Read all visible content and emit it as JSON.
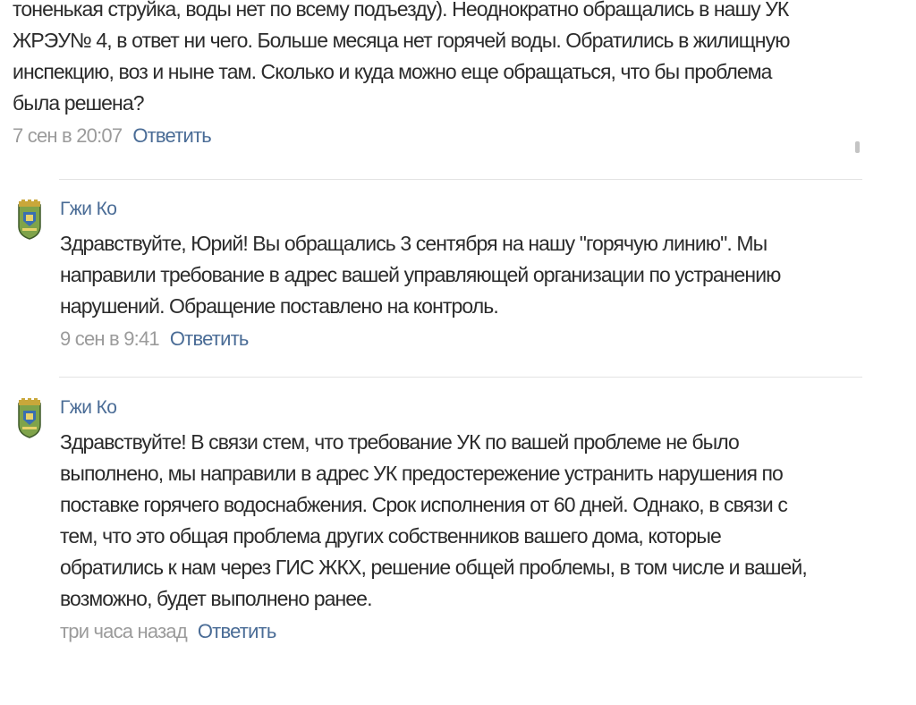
{
  "comments": [
    {
      "lines": [
        "тоненькая струйка, воды нет по всему подъезду). Неоднократно обращались в нашу УК",
        "ЖРЭУ№ 4, в ответ ни чего. Больше месяца нет горячей воды. Обратились в жилищную",
        "инспекцию, воз и ныне там. Сколько и куда можно еще обращаться, что бы проблема",
        "была решена?"
      ],
      "time": "7 сен в 20:07",
      "reply_label": "Ответить"
    },
    {
      "author": "Гжи Ко",
      "avatar_icon": "coat-of-arms-icon",
      "lines": [
        "Здравствуйте, Юрий! Вы обращались 3 сентября на нашу \"горячую линию\". Мы",
        "направили требование в адрес вашей управляющей организации по устранению",
        "нарушений. Обращение поставлено на контроль."
      ],
      "time": "9 сен в 9:41",
      "reply_label": "Ответить"
    },
    {
      "author": "Гжи Ко",
      "avatar_icon": "coat-of-arms-icon",
      "lines": [
        "Здравствуйте! В связи стем, что требование УК по вашей проблеме не было",
        "выполнено, мы направили в адрес УК предостережение устранить нарушения по",
        "поставке горячего водоснабжения. Срок исполнения от 60 дней. Однако, в связи с",
        "тем, что это общая проблема других собственников вашего дома, которые",
        "обратились к нам через ГИС ЖКХ, решение общей проблемы, в том числе и вашей,",
        "возможно, будет выполнено ранее."
      ],
      "time": "три часа назад",
      "reply_label": "Ответить"
    }
  ],
  "colors": {
    "link": "#4a6c96",
    "time": "#9b9b9b",
    "text": "#2b2b2b",
    "divider": "#e3e3e3"
  }
}
